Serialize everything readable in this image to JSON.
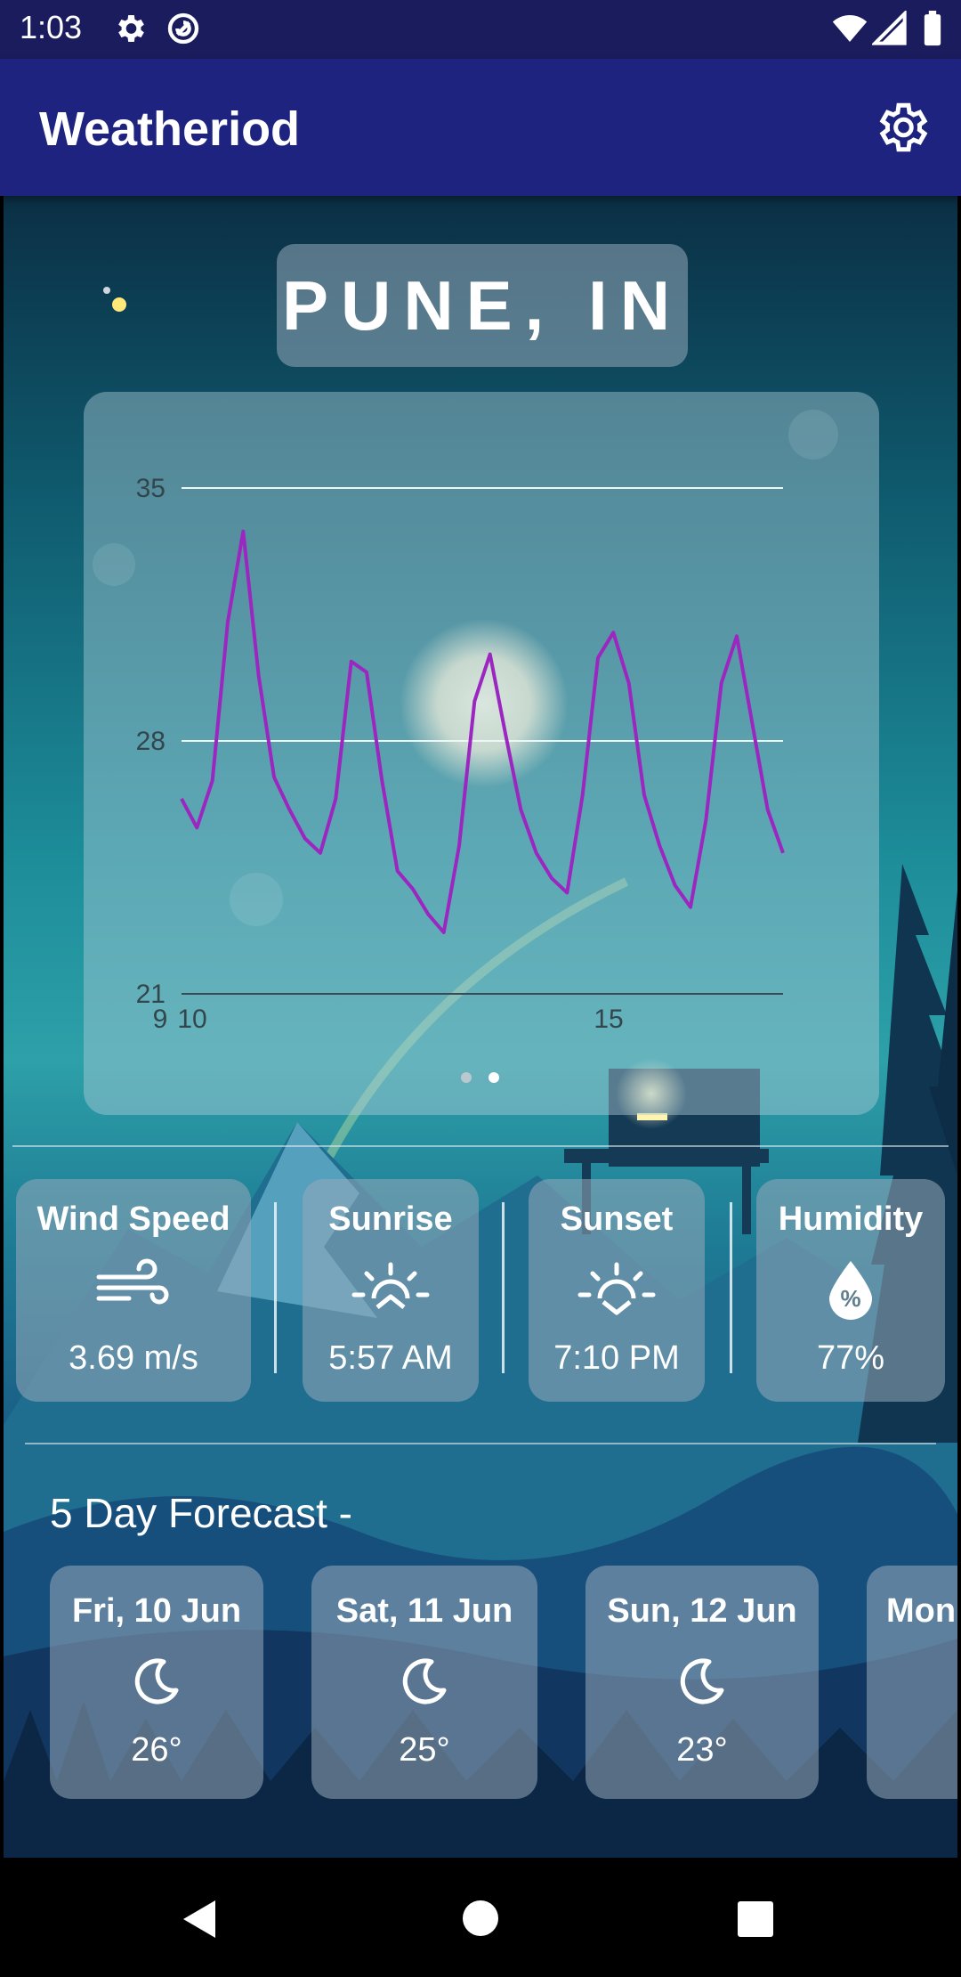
{
  "status_bar": {
    "time": "1:03",
    "icons": [
      "gear-icon",
      "at-icon",
      "wifi-icon",
      "signal-icon",
      "battery-icon"
    ]
  },
  "app_bar": {
    "title": "Weatheriod",
    "settings_icon": "gear-icon"
  },
  "location": {
    "label": "PUNE, IN"
  },
  "chart_data": {
    "type": "line",
    "y_ticks": [
      "35",
      "28",
      "21"
    ],
    "x_ticks": [
      "9",
      "10",
      "15"
    ],
    "ylim": [
      21,
      35
    ],
    "x": [
      0,
      1,
      2,
      3,
      4,
      5,
      6,
      7,
      8,
      9,
      10,
      11,
      12,
      13,
      14,
      15,
      16,
      17,
      18,
      19,
      20,
      21,
      22,
      23,
      24,
      25,
      26,
      27,
      28,
      29,
      30,
      31,
      32,
      33,
      34,
      35,
      36,
      37,
      38,
      39
    ],
    "series": [
      {
        "color": "#9b27c0",
        "values": [
          26.4,
          25.6,
          26.9,
          31.3,
          33.8,
          29.8,
          27.0,
          26.1,
          25.3,
          24.9,
          26.4,
          30.2,
          29.9,
          26.9,
          24.4,
          23.9,
          23.2,
          22.7,
          25.1,
          29.1,
          30.4,
          28.2,
          26.1,
          24.9,
          24.2,
          23.8,
          26.5,
          30.3,
          31.0,
          29.6,
          26.5,
          25.1,
          24.0,
          23.4,
          25.8,
          29.6,
          30.9,
          28.5,
          26.1,
          24.9
        ]
      }
    ],
    "pager": {
      "pages": 2,
      "active": 1
    },
    "grid": true
  },
  "stats": [
    {
      "label": "Wind Speed",
      "value": "3.69 m/s",
      "icon": "wind-icon"
    },
    {
      "label": "Sunrise",
      "value": "5:57 AM",
      "icon": "sunrise-icon"
    },
    {
      "label": "Sunset",
      "value": "7:10 PM",
      "icon": "sunset-icon"
    },
    {
      "label": "Humidity",
      "value": "77%",
      "icon": "humidity-icon"
    }
  ],
  "forecast": {
    "title": "5 Day Forecast -",
    "days": [
      {
        "day": "Fri, 10 Jun",
        "temp": "26°",
        "icon": "moon-icon"
      },
      {
        "day": "Sat, 11 Jun",
        "temp": "25°",
        "icon": "moon-icon"
      },
      {
        "day": "Sun, 12 Jun",
        "temp": "23°",
        "icon": "moon-icon"
      },
      {
        "day": "Mon",
        "temp": "",
        "icon": "moon-icon"
      }
    ]
  },
  "nav_bar": {
    "buttons": [
      "back-icon",
      "home-icon",
      "recents-icon"
    ]
  }
}
